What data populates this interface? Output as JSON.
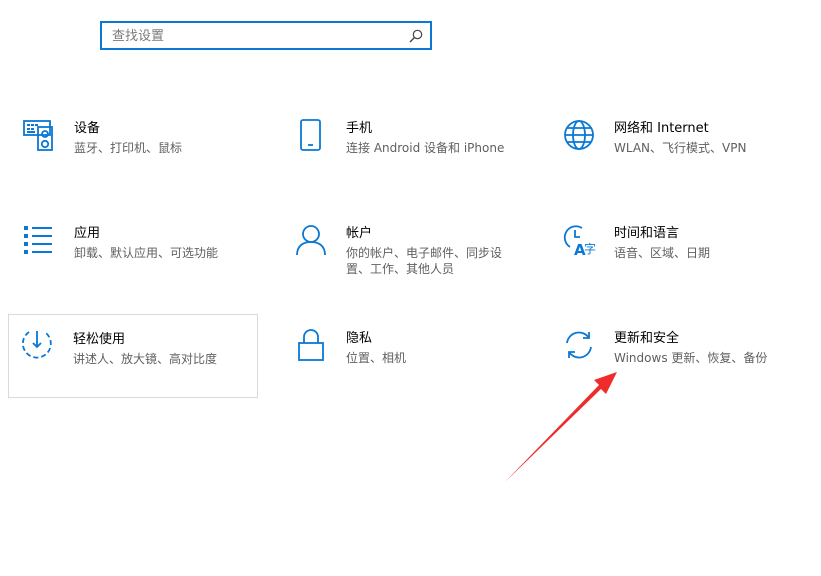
{
  "search": {
    "placeholder": "查找设置",
    "value": ""
  },
  "tiles": [
    {
      "title": "设备",
      "desc": "蓝牙、打印机、鼠标"
    },
    {
      "title": "手机",
      "desc": "连接 Android 设备和 iPhone"
    },
    {
      "title": "网络和 Internet",
      "desc": "WLAN、飞行模式、VPN"
    },
    {
      "title": "应用",
      "desc": "卸载、默认应用、可选功能"
    },
    {
      "title": "帐户",
      "desc": "你的帐户、电子邮件、同步设置、工作、其他人员"
    },
    {
      "title": "时间和语言",
      "desc": "语音、区域、日期"
    },
    {
      "title": "轻松使用",
      "desc": "讲述人、放大镜、高对比度"
    },
    {
      "title": "隐私",
      "desc": "位置、相机"
    },
    {
      "title": "更新和安全",
      "desc": "Windows 更新、恢复、备份"
    }
  ],
  "icons": [
    "keyboard-printer-icon",
    "phone-icon",
    "globe-icon",
    "apps-list-icon",
    "person-icon",
    "time-language-icon",
    "ease-of-access-icon",
    "lock-icon",
    "sync-icon"
  ],
  "colors": {
    "accent": "#0a78d4",
    "arrow": "#ee2c2c",
    "desc_text": "#5f5f5f"
  }
}
